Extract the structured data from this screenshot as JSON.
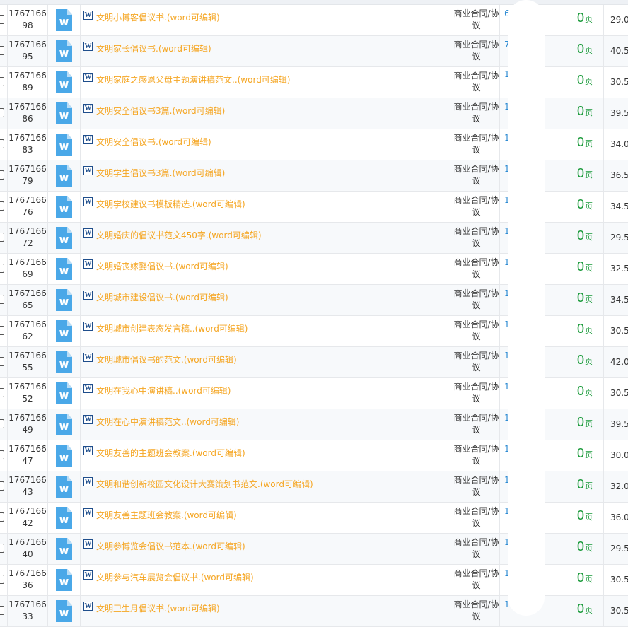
{
  "rows": [
    {
      "id_top": "1767166",
      "id_bottom": "98",
      "title": "文明小博客倡议书.(word可编辑)",
      "category": "商业合同/协议",
      "author": "6/以",
      "pages": "0",
      "page_unit": "页",
      "price": "29.0"
    },
    {
      "id_top": "1767166",
      "id_bottom": "95",
      "title": "文明家长倡议书.(word可编辑)",
      "category": "商业合同/协议",
      "author": "7 /以",
      "pages": "0",
      "page_unit": "页",
      "price": "40.5"
    },
    {
      "id_top": "1767166",
      "id_bottom": "89",
      "title": "文明家庭之感恩父母主题演讲稿范文..(word可编辑)",
      "category": "商业合同/协议",
      "author": "1",
      "pages": "0",
      "page_unit": "页",
      "price": "30.5"
    },
    {
      "id_top": "1767166",
      "id_bottom": "86",
      "title": "文明安全倡议书3篇.(word可编辑)",
      "category": "商业合同/协议",
      "author": "10 以",
      "pages": "0",
      "page_unit": "页",
      "price": "39.5"
    },
    {
      "id_top": "1767166",
      "id_bottom": "83",
      "title": "文明安全倡议书.(word可编辑)",
      "category": "商业合同/协议",
      "author": "10 以",
      "pages": "0",
      "page_unit": "页",
      "price": "34.0"
    },
    {
      "id_top": "1767166",
      "id_bottom": "79",
      "title": "文明学生倡议书3篇.(word可编辑)",
      "category": "商业合同/协议",
      "author": "10 以",
      "pages": "0",
      "page_unit": "页",
      "price": "36.5"
    },
    {
      "id_top": "1767166",
      "id_bottom": "76",
      "title": "文明学校建议书模板精选.(word可编辑)",
      "category": "商业合同/协议",
      "author": "10 以",
      "pages": "0",
      "page_unit": "页",
      "price": "34.5"
    },
    {
      "id_top": "1767166",
      "id_bottom": "72",
      "title": "文明婚庆的倡议书范文450字.(word可编辑)",
      "category": "商业合同/协议",
      "author": "10 以",
      "pages": "0",
      "page_unit": "页",
      "price": "29.5"
    },
    {
      "id_top": "1767166",
      "id_bottom": "69",
      "title": "文明婚丧嫁娶倡议书.(word可编辑)",
      "category": "商业合同/协议",
      "author": "10 以",
      "pages": "0",
      "page_unit": "页",
      "price": "32.5"
    },
    {
      "id_top": "1767166",
      "id_bottom": "65",
      "title": "文明城市建设倡议书.(word可编辑)",
      "category": "商业合同/协议",
      "author": "10 以",
      "pages": "0",
      "page_unit": "页",
      "price": "34.5"
    },
    {
      "id_top": "1767166",
      "id_bottom": "62",
      "title": "文明城市创建表态发言稿..(word可编辑)",
      "category": "商业合同/协议",
      "author": "10 以",
      "pages": "0",
      "page_unit": "页",
      "price": "30.5"
    },
    {
      "id_top": "1767166",
      "id_bottom": "55",
      "title": "文明城市倡议书的范文.(word可编辑)",
      "category": "商业合同/协议",
      "author": "1 以",
      "pages": "0",
      "page_unit": "页",
      "price": "42.0"
    },
    {
      "id_top": "1767166",
      "id_bottom": "52",
      "title": "文明在我心中演讲稿..(word可编辑)",
      "category": "商业合同/协议",
      "author": "1 /以",
      "pages": "0",
      "page_unit": "页",
      "price": "30.5"
    },
    {
      "id_top": "1767166",
      "id_bottom": "49",
      "title": "文明在心中演讲稿范文..(word可编辑)",
      "category": "商业合同/协议",
      "author": "1 /以",
      "pages": "0",
      "page_unit": "页",
      "price": "39.5"
    },
    {
      "id_top": "1767166",
      "id_bottom": "47",
      "title": "文明友善的主题班会教案.(word可编辑)",
      "category": "商业合同/协议",
      "author": "1 /以",
      "pages": "0",
      "page_unit": "页",
      "price": "30.0"
    },
    {
      "id_top": "1767166",
      "id_bottom": "43",
      "title": "文明和谐创新校园文化设计大赛策划书范文.(word可编辑)",
      "category": "商业合同/协议",
      "author": "1 /以",
      "pages": "0",
      "page_unit": "页",
      "price": "32.0"
    },
    {
      "id_top": "1767166",
      "id_bottom": "42",
      "title": "文明友善主题班会教案.(word可编辑)",
      "category": "商业合同/协议",
      "author": "1 /以",
      "pages": "0",
      "page_unit": "页",
      "price": "36.0"
    },
    {
      "id_top": "1767166",
      "id_bottom": "40",
      "title": "文明参博览会倡议书范本.(word可编辑)",
      "category": "商业合同/协议",
      "author": "1 /以",
      "pages": "0",
      "page_unit": "页",
      "price": "29.5"
    },
    {
      "id_top": "1767166",
      "id_bottom": "36",
      "title": "文明参与汽车展览会倡议书.(word可编辑)",
      "category": "商业合同/协议",
      "author": "1 /以",
      "pages": "0",
      "page_unit": "页",
      "price": "30.5"
    },
    {
      "id_top": "1767166",
      "id_bottom": "33",
      "title": "文明卫生月倡议书.(word可编辑)",
      "category": "商业合同/协议",
      "author": "1 /以",
      "pages": "0",
      "page_unit": "页",
      "price": "30.5"
    }
  ],
  "icons": {
    "file_icon": "word-file-icon",
    "badge_icon": "word-badge-icon",
    "badge_letter": "W",
    "file_letter": "W"
  },
  "colors": {
    "title": "#f5a623",
    "pages": "#1a9a3a",
    "author": "#2f8cd3",
    "file_icon": "#4aa8e8"
  }
}
